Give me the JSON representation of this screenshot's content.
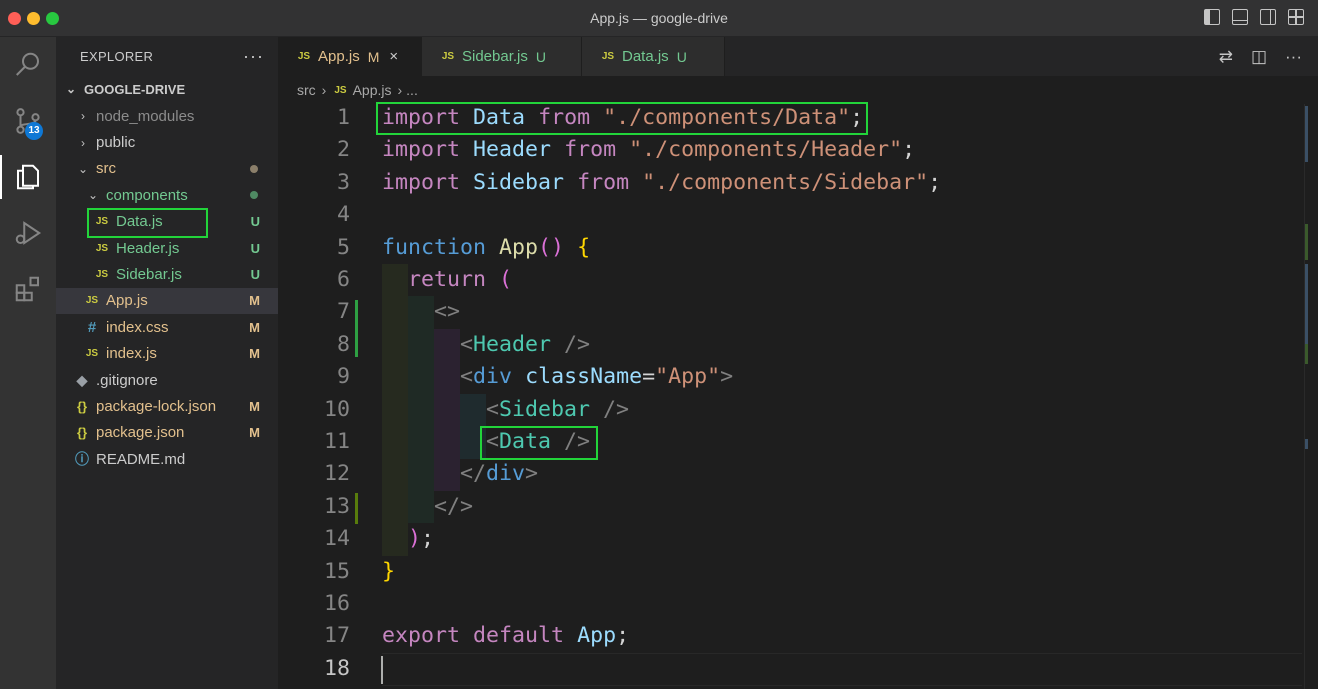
{
  "window": {
    "title": "App.js — google-drive"
  },
  "activity_bar": {
    "scm_badge": "13"
  },
  "explorer": {
    "header": "EXPLORER",
    "more": "···",
    "root": "GOOGLE-DRIVE",
    "items": [
      {
        "name": "node_modules",
        "status": ""
      },
      {
        "name": "public",
        "status": ""
      },
      {
        "name": "src",
        "status": ""
      },
      {
        "name": "components",
        "status": ""
      },
      {
        "name": "Data.js",
        "status": "U",
        "icon": "JS"
      },
      {
        "name": "Header.js",
        "status": "U",
        "icon": "JS"
      },
      {
        "name": "Sidebar.js",
        "status": "U",
        "icon": "JS"
      },
      {
        "name": "App.js",
        "status": "M",
        "icon": "JS"
      },
      {
        "name": "index.css",
        "status": "M",
        "icon": "#"
      },
      {
        "name": "index.js",
        "status": "M",
        "icon": "JS"
      },
      {
        "name": ".gitignore",
        "status": ""
      },
      {
        "name": "package-lock.json",
        "status": "M",
        "icon": "{}"
      },
      {
        "name": "package.json",
        "status": "M",
        "icon": "{}"
      },
      {
        "name": "README.md",
        "status": ""
      }
    ]
  },
  "tabs": [
    {
      "label": "App.js",
      "status": "M",
      "icon": "JS",
      "close": "×"
    },
    {
      "label": "Sidebar.js",
      "status": "U",
      "icon": "JS"
    },
    {
      "label": "Data.js",
      "status": "U",
      "icon": "JS"
    }
  ],
  "breadcrumb": {
    "folder": "src",
    "sep1": "›",
    "file_icon": "JS",
    "file": "App.js",
    "sep2": "›",
    "more": "..."
  },
  "editor": {
    "line_numbers": [
      "1",
      "2",
      "3",
      "4",
      "5",
      "6",
      "7",
      "8",
      "9",
      "10",
      "11",
      "12",
      "13",
      "14",
      "15",
      "16",
      "17",
      "18"
    ],
    "lines": {
      "l1": {
        "kw": "import",
        "name": "Data",
        "from": "from",
        "path": "\"./components/Data\"",
        "semi": ";"
      },
      "l2": {
        "kw": "import",
        "name": "Header",
        "from": "from",
        "path": "\"./components/Header\"",
        "semi": ";"
      },
      "l3": {
        "kw": "import",
        "name": "Sidebar",
        "from": "from",
        "path": "\"./components/Sidebar\"",
        "semi": ";"
      },
      "l5": {
        "kw": "function",
        "name": "App",
        "parens": "()",
        "brace": "{"
      },
      "l6": {
        "kw": "return",
        "paren": "("
      },
      "l7": {
        "frag": "<>"
      },
      "l8": {
        "lt": "<",
        "tag": "Header",
        "close": " />"
      },
      "l9": {
        "lt": "<",
        "tag": "div",
        "attr": "className",
        "eq": "=",
        "val": "\"App\"",
        "gt": ">"
      },
      "l10": {
        "lt": "<",
        "tag": "Sidebar",
        "close": " />"
      },
      "l11": {
        "lt": "<",
        "tag": "Data",
        "close": " />"
      },
      "l12": {
        "lt": "</",
        "tag": "div",
        "gt": ">"
      },
      "l13": {
        "frag": "</>"
      },
      "l14": {
        "paren": ")",
        "semi": ";"
      },
      "l15": {
        "brace": "}"
      },
      "l17": {
        "kw1": "export",
        "kw2": "default",
        "name": "App",
        "semi": ";"
      }
    }
  }
}
